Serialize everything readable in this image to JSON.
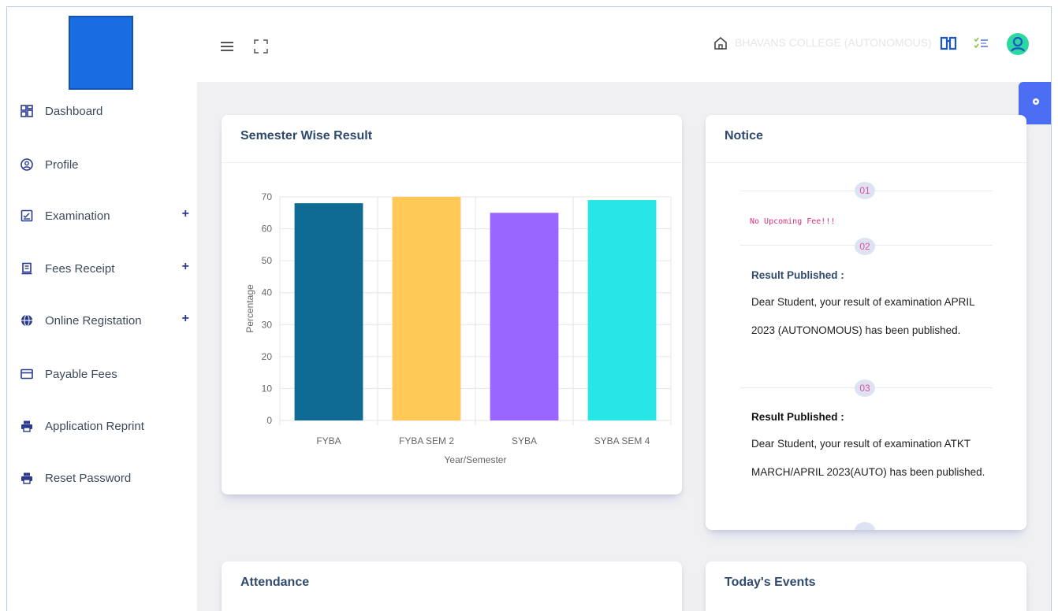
{
  "sidebar": {
    "items": [
      {
        "label": "Dashboard",
        "icon": "dashboard-icon",
        "expandable": false
      },
      {
        "label": "Profile",
        "icon": "user-circle-icon",
        "expandable": false
      },
      {
        "label": "Examination",
        "icon": "exam-icon",
        "expandable": true
      },
      {
        "label": "Fees Receipt",
        "icon": "receipt-icon",
        "expandable": true
      },
      {
        "label": "Online Registation",
        "icon": "globe-icon",
        "expandable": true
      },
      {
        "label": "Payable Fees",
        "icon": "card-icon",
        "expandable": false
      },
      {
        "label": "Application Reprint",
        "icon": "printer-icon",
        "expandable": false
      },
      {
        "label": "Reset Password",
        "icon": "printer-icon",
        "expandable": false
      }
    ],
    "expand_symbol": "+"
  },
  "header": {
    "college_name": "BHAVANS COLLEGE (AUTONOMOUS)"
  },
  "result_card": {
    "title": "Semester Wise Result"
  },
  "chart_data": {
    "type": "bar",
    "categories": [
      "FYBA",
      "FYBA SEM 2",
      "SYBA",
      "SYBA SEM 4"
    ],
    "values": [
      68,
      70,
      65,
      69
    ],
    "colors": [
      "#0f6b93",
      "#ffc857",
      "#9966ff",
      "#29e6e6"
    ],
    "xlabel": "Year/Semester",
    "ylabel": "Percentage",
    "ylim": [
      0,
      70
    ],
    "yticks": [
      0,
      10,
      20,
      30,
      40,
      50,
      60,
      70
    ],
    "grid": true
  },
  "notice_card": {
    "title": "Notice",
    "items": [
      {
        "badge": "01",
        "text": "No Upcoming Fee!!!"
      },
      {
        "badge": "02",
        "heading": "Result Published :",
        "line1": "Dear Student, your result of examination APRIL",
        "line2": "2023 (AUTONOMOUS) has been published."
      },
      {
        "badge": "03",
        "heading": "Result Published :",
        "line1": "Dear Student, your result of examination ATKT",
        "line2": "MARCH/APRIL 2023(AUTO) has been published."
      }
    ]
  },
  "attendance_card": {
    "title": "Attendance"
  },
  "events_card": {
    "title": "Today's Events"
  },
  "colors": {
    "accent": "#4c6ef5",
    "title": "#2f4a6d",
    "badge_text": "#e24fa0"
  }
}
